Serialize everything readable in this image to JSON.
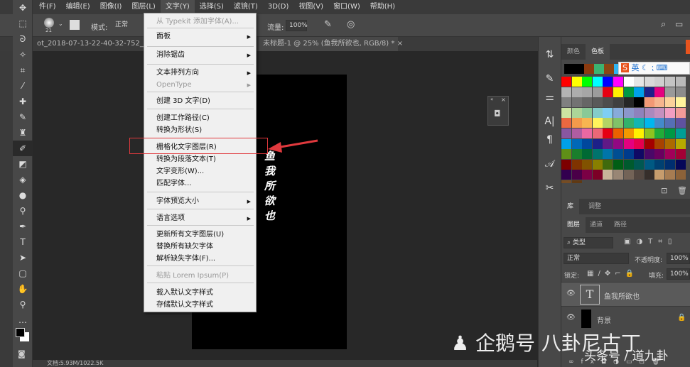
{
  "menubar": {
    "items": [
      "件(F)",
      "编辑(E)",
      "图像(I)",
      "图层(L)",
      "文字(Y)",
      "选择(S)",
      "滤镜(T)",
      "3D(D)",
      "视图(V)",
      "窗口(W)",
      "帮助(H)"
    ],
    "active_index": 4
  },
  "options": {
    "brush_size": "21",
    "mode_label": "模式:",
    "mode_value": "正常",
    "flow_label": "流量:",
    "flow_value": "100%"
  },
  "tabs": [
    {
      "label": "ot_2018-07-13-22-40-32-752_com"
    },
    {
      "label": "未标题-1 @ 25% (鱼我所欲也, RGB/8) *"
    }
  ],
  "canvas_text": "鱼我所欲也",
  "status": "文档:5.93M/1022.5K",
  "type_menu": {
    "items": [
      {
        "label": "从 Typekit 添加字体(A)...",
        "disabled": true,
        "submenu": false
      },
      {
        "label": "面板",
        "submenu": true
      },
      {
        "label": "消除锯齿",
        "submenu": true
      },
      {
        "label": "文本排列方向",
        "submenu": true
      },
      {
        "label": "OpenType",
        "disabled": true,
        "submenu": true
      },
      {
        "label": "创建 3D 文字(D)"
      },
      {
        "label": "创建工作路径(C)"
      },
      {
        "label": "转换为形状(S)"
      },
      {
        "label": "栅格化文字图层(R)",
        "highlighted": true
      },
      {
        "label": "转换为段落文本(T)"
      },
      {
        "label": "文字变形(W)..."
      },
      {
        "label": "匹配字体..."
      },
      {
        "label": "字体预览大小",
        "submenu": true
      },
      {
        "label": "语言选项",
        "submenu": true
      },
      {
        "label": "更新所有文字图层(U)"
      },
      {
        "label": "替换所有缺欠字体"
      },
      {
        "label": "解析缺失字体(F)..."
      },
      {
        "label": "粘贴 Lorem Ipsum(P)",
        "disabled": true
      },
      {
        "label": "载入默认文字样式"
      },
      {
        "label": "存储默认文字样式"
      }
    ]
  },
  "annotation_color": "#e0393d",
  "color_panel": {
    "tabs": [
      "颜色",
      "色板"
    ],
    "active": 1,
    "recent": [
      "#000000",
      "#000000",
      "#8b3a0f",
      "#3cb371",
      "#8b4513",
      "#2fb4f0"
    ],
    "swatches": [
      [
        "#ff0000",
        "#ffff00",
        "#00ff00",
        "#00ffff",
        "#0000ff",
        "#ff00ff",
        "#ffffff",
        "#e6e6e6",
        "#d9d9d9",
        "#cfcfcf",
        "#c4c4c4",
        "#bababa"
      ],
      [
        "#b3b3b3",
        "#adadad",
        "#a6a6a6",
        "#9c9c9c",
        "#e60012",
        "#fff100",
        "#009944",
        "#00a0e9",
        "#1d2088",
        "#e4007f",
        "#999999",
        "#8c8c8c"
      ],
      [
        "#808080",
        "#737373",
        "#666666",
        "#595959",
        "#4d4d4d",
        "#404040",
        "#262626",
        "#000000",
        "#f19975",
        "#f5b58e",
        "#fbd29a",
        "#fff59c"
      ],
      [
        "#cde4a2",
        "#acd598",
        "#89c997",
        "#84ccc9",
        "#7ecef4",
        "#88abda",
        "#8c97cb",
        "#8f82bc",
        "#aa89bd",
        "#c490bf",
        "#f19ec2",
        "#f29b98"
      ],
      [
        "#eb6841",
        "#f39a4b",
        "#f8b551",
        "#fff45c",
        "#b3d465",
        "#80c269",
        "#32b16c",
        "#13b5b1",
        "#00b7ee",
        "#448aca",
        "#556fb5",
        "#5f52a0"
      ],
      [
        "#8957a1",
        "#ae5da1",
        "#ea68a2",
        "#eb6877",
        "#e60012",
        "#eb6100",
        "#f39800",
        "#fff100",
        "#8fc31f",
        "#22ac38",
        "#009944",
        "#009e96"
      ],
      [
        "#00a0e9",
        "#0068b7",
        "#00479d",
        "#1d2088",
        "#601986",
        "#920783",
        "#e4007f",
        "#e5004f",
        "#a40000",
        "#a84200",
        "#ac6a00",
        "#b7aa00"
      ],
      [
        "#5f8f17",
        "#1a7e2c",
        "#006934",
        "#00736d",
        "#0075a9",
        "#004e92",
        "#003b8c",
        "#100964",
        "#4a0867",
        "#6a005f",
        "#a10059",
        "#a20035"
      ],
      [
        "#7d0000",
        "#7f3300",
        "#815200",
        "#887f00",
        "#3f6a0d",
        "#005e15",
        "#005a2e",
        "#005852",
        "#005982",
        "#004071",
        "#002e6f",
        "#050758"
      ],
      [
        "#32004f",
        "#4a0048",
        "#7b0045",
        "#7c0026",
        "#c7b299",
        "#998675",
        "#736357",
        "#534741",
        "#362e2b",
        "#c69c6d",
        "#a67c52",
        "#8c6239"
      ],
      [
        "#754c24",
        "#603913"
      ]
    ]
  },
  "ime": {
    "label": "英"
  },
  "library_tabs": [
    "库",
    "调整"
  ],
  "layers_panel": {
    "tabs": [
      "图层",
      "通道",
      "路径"
    ],
    "filter": "类型",
    "blend": "正常",
    "opacity_label": "不透明度:",
    "opacity": "100%",
    "lock_label": "锁定:",
    "fill_label": "填充:",
    "fill": "100%",
    "layers": [
      {
        "name": "鱼我所欲也",
        "type": "text",
        "thumb": "T",
        "selected": true
      },
      {
        "name": "背景",
        "type": "background",
        "locked": true
      }
    ]
  },
  "watermark": {
    "line1": "企鹅号 八卦尼古丁",
    "line2": "头条号 / 道九卦"
  }
}
